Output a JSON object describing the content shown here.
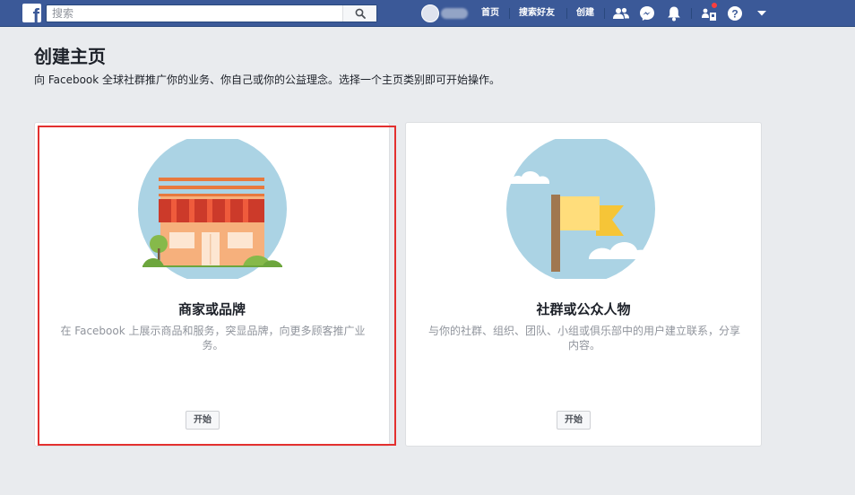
{
  "topbar": {
    "logo_letter": "f",
    "search_placeholder": "搜索",
    "nav": {
      "home": "首页",
      "find_friends": "搜索好友",
      "create": "创建"
    }
  },
  "page": {
    "title": "创建主页",
    "description": "向 Facebook 全球社群推广你的业务、你自己或你的公益理念。选择一个主页类别即可开始操作。"
  },
  "cards": [
    {
      "title": "商家或品牌",
      "description": "在 Facebook 上展示商品和服务，突显品牌，向更多顾客推广业务。",
      "button": "开始"
    },
    {
      "title": "社群或公众人物",
      "description": "与你的社群、组织、团队、小组或俱乐部中的用户建立联系，分享内容。",
      "button": "开始"
    }
  ],
  "colors": {
    "brand": "#3b5998",
    "highlight": "#e3302f",
    "background": "#e9ebee"
  }
}
